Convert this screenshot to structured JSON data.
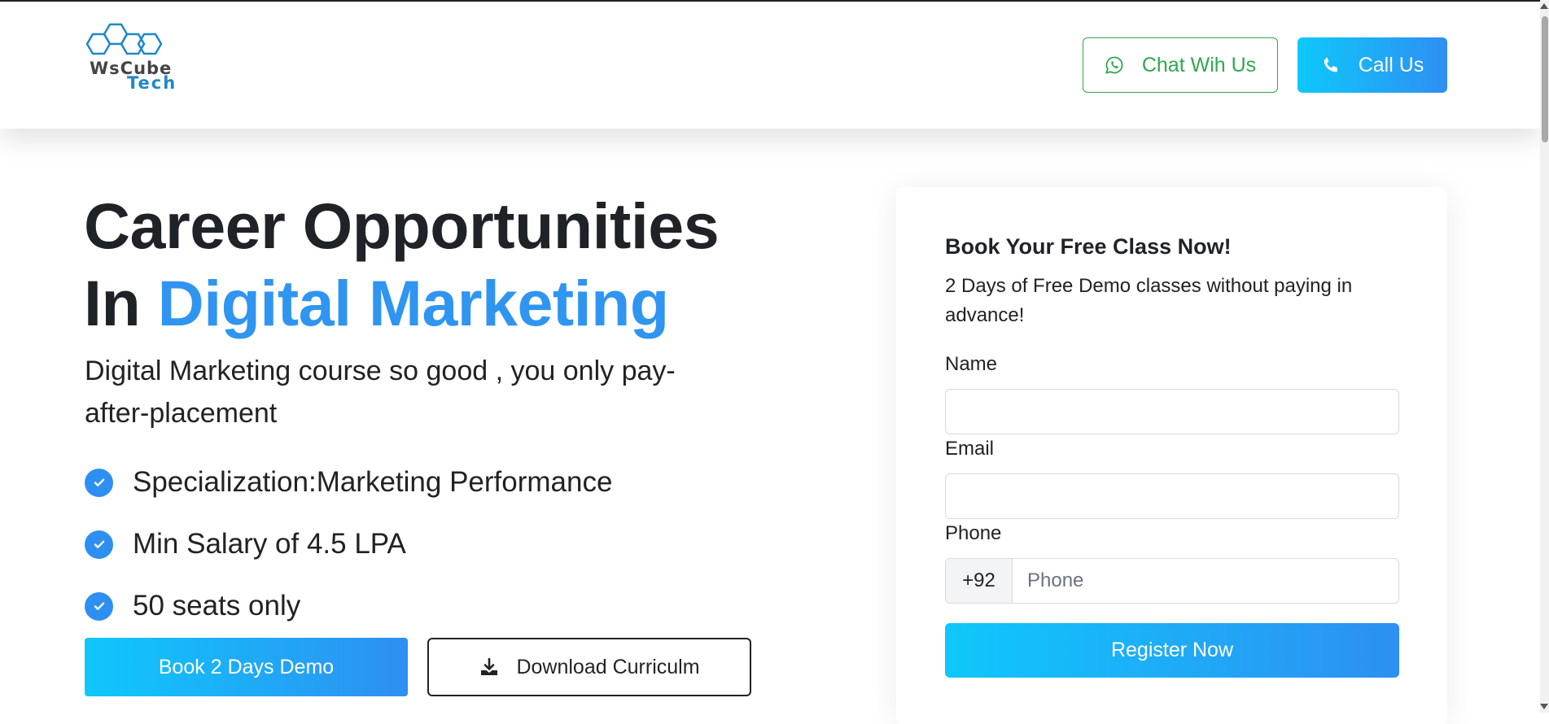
{
  "header": {
    "logo_line1": "WsCube",
    "logo_line2": "Tech",
    "chat_label": "Chat Wih Us",
    "call_label": "Call Us"
  },
  "hero": {
    "title_line1": "Career Opportunities",
    "title_line2_prefix": "In",
    "title_line2_accent": "Digital Marketing",
    "subtitle": "Digital Marketing course so good , you only pay-after-placement",
    "features": [
      "Specialization:Marketing Performance",
      "Min Salary of 4.5 LPA",
      "50 seats only"
    ],
    "demo_button": "Book 2 Days Demo",
    "curriculum_button": "Download Curriculm"
  },
  "form": {
    "title": "Book Your Free Class Now!",
    "subtitle": "2 Days of Free Demo classes without paying in advance!",
    "name_label": "Name",
    "email_label": "Email",
    "phone_label": "Phone",
    "phone_code": "+92",
    "phone_placeholder": "Phone",
    "register_button": "Register Now"
  },
  "icons": {
    "chat": "whatsapp-icon",
    "call": "phone-icon",
    "feature": "check-circle-icon",
    "download": "download-icon"
  },
  "colors": {
    "accent": "#2f95f0",
    "gradient_start": "#0ec8fb",
    "gradient_end": "#2e8ff2",
    "whatsapp_green": "#2fa84f"
  }
}
